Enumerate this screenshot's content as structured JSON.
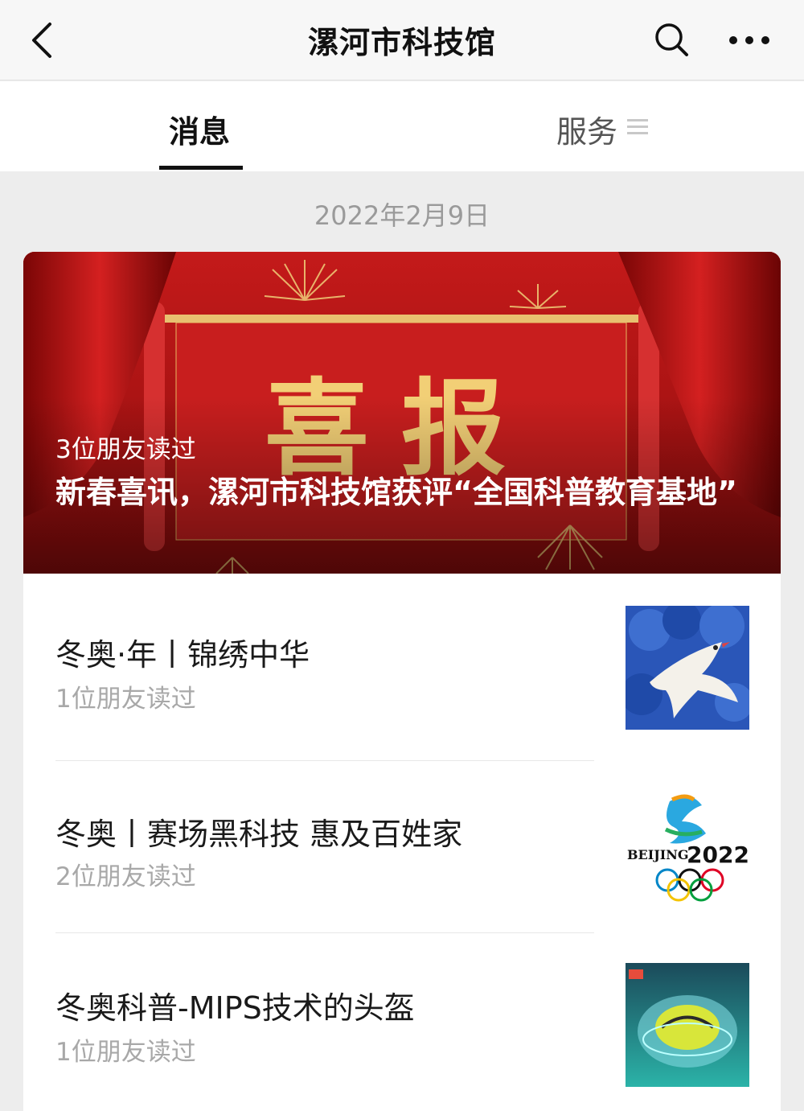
{
  "nav": {
    "title": "漯河市科技馆",
    "back_icon": "chevron-left-icon",
    "search_icon": "search-icon",
    "more_icon": "more-dots-icon"
  },
  "tabs": {
    "messages_label": "消息",
    "services_label": "服务",
    "services_menu_icon": "menu-lines-icon"
  },
  "feed": {
    "date": "2022年2月9日",
    "hero": {
      "read_count": "3位朋友读过",
      "title": "新春喜讯，漯河市科技馆获评“全国科普教育基地”",
      "banner_text": "喜报"
    },
    "articles": [
      {
        "title": "冬奥·年丨锦绣中华",
        "read_count": "1位朋友读过",
        "thumb": "dove-image"
      },
      {
        "title": "冬奥丨赛场黑科技 惠及百姓家",
        "read_count": "2位朋友读过",
        "thumb": "beijing-2022-logo",
        "logo_text": "BEIJING",
        "logo_year": "2022"
      },
      {
        "title": "冬奥科普-MIPS技术的头盔",
        "read_count": "1位朋友读过",
        "thumb": "helmet-image"
      }
    ]
  },
  "colors": {
    "hero_red": "#b81414",
    "gold": "#f0cf7a",
    "tab_underline": "#111111"
  }
}
